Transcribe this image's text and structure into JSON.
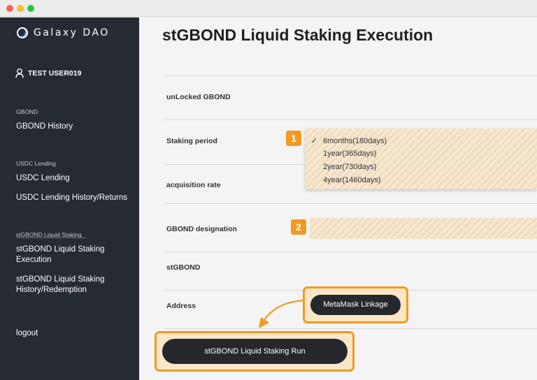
{
  "window": {
    "controls": [
      "close",
      "minimize",
      "zoom"
    ]
  },
  "sidebar": {
    "logo_text": "Galaxy DAO",
    "user_label": "TEST USER019",
    "sections": [
      {
        "label": "GBOND",
        "items": [
          "GBOND History"
        ]
      },
      {
        "label": "USDC Lending",
        "items": [
          "USDC Lending",
          "USDC Lending History/Returns"
        ]
      },
      {
        "label": "stGBOND Liquid Staking",
        "items": [
          "stGBOND Liquid Staking Execution",
          "stGBOND Liquid Staking History/Redemption"
        ]
      }
    ],
    "logout": "logout"
  },
  "main": {
    "title": "stGBOND Liquid Staking Execution",
    "rows": {
      "unlocked": "unLocked GBOND",
      "staking_period": "Staking period",
      "acquisition_rate": "acquisition rate",
      "gbond_designation": "GBOND designation",
      "stgbond": "stGBOND",
      "address": "Address"
    },
    "staking_period_options": [
      "6months(180days)",
      "1year(365days)",
      "2year(730days)",
      "4year(1460days)"
    ],
    "selected_option_mark": "✓",
    "badges": [
      "1",
      "2"
    ],
    "metamask_button": "MetaMask Linkage",
    "run_button": "stGBOND Liquid Staking Run"
  },
  "colors": {
    "highlight": "#f29a23",
    "sidebar_bg": "#262a33",
    "field_bg": "#f1ddbf"
  }
}
